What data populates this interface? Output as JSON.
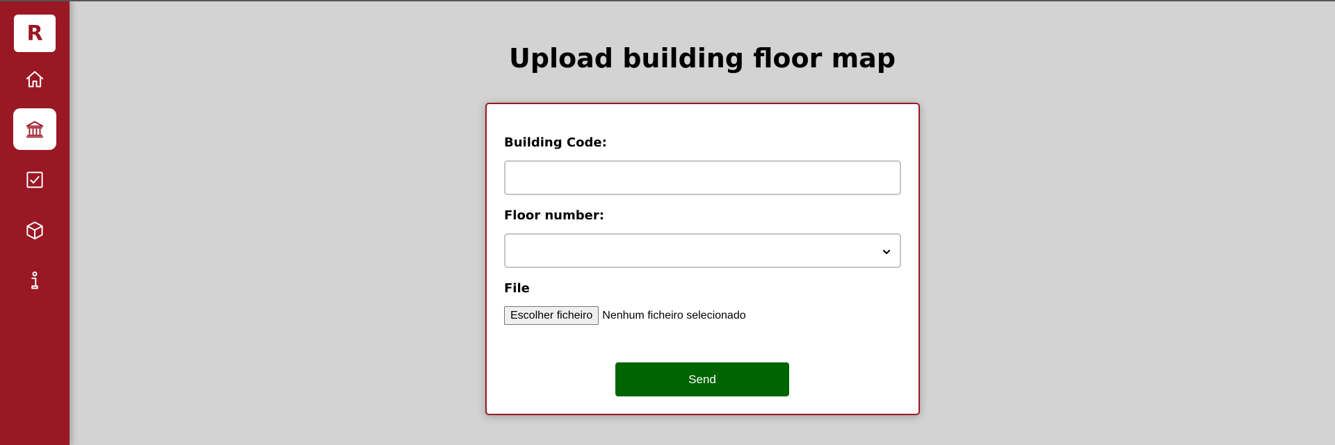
{
  "colors": {
    "sidebar_bg": "#9a1724",
    "page_bg": "#d3d3d3",
    "card_border": "#9a1724",
    "send_button_bg": "#006400"
  },
  "sidebar": {
    "logo_text": "R",
    "items": [
      {
        "icon": "home-icon",
        "active": false
      },
      {
        "icon": "bank-building-icon",
        "active": true
      },
      {
        "icon": "checkbox-icon",
        "active": false
      },
      {
        "icon": "cube-icon",
        "active": false
      },
      {
        "icon": "info-icon",
        "active": false
      }
    ]
  },
  "main": {
    "title": "Upload building floor map"
  },
  "form": {
    "building_code_label": "Building Code:",
    "building_code_value": "",
    "floor_number_label": "Floor number:",
    "floor_number_value": "",
    "file_label": "File",
    "file_button_label": "Escolher ficheiro",
    "file_status": "Nenhum ficheiro selecionado",
    "send_label": "Send"
  }
}
